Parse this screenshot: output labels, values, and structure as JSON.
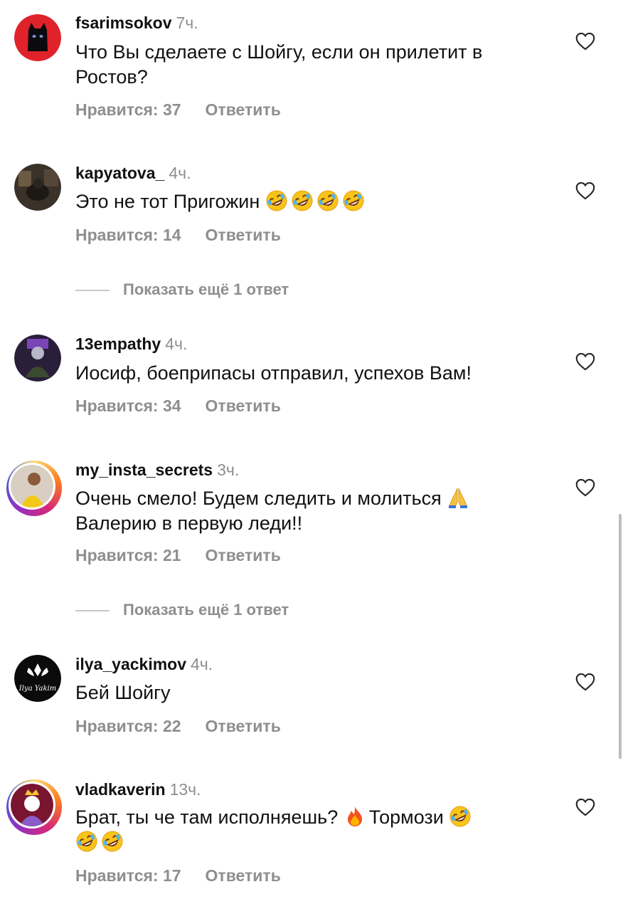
{
  "comments": [
    {
      "username": "fsarimsokov",
      "time": "7ч.",
      "text": "Что Вы сделаете с Шойгу, если он прилетит в Ростов?",
      "likes_label": "Нравится: 37",
      "reply_label": "Ответить",
      "avatar_icon": "black-cat-avatar",
      "avatar_color": "#e0222b"
    },
    {
      "username": "kapyatova_",
      "time": "4ч.",
      "text": "Это не тот Пригожин",
      "emoji": [
        "rofl-emoji",
        "rofl-emoji",
        "rofl-emoji",
        "rofl-emoji"
      ],
      "likes_label": "Нравится: 14",
      "reply_label": "Ответить",
      "avatar_icon": "dark-room-photo-avatar"
    },
    {
      "username": "13empathy",
      "time": "4ч.",
      "text": "Иосиф, боеприпасы отправил, успехов Вам!",
      "likes_label": "Нравится: 34",
      "reply_label": "Ответить",
      "avatar_icon": "purple-figure-avatar"
    },
    {
      "username": "my_insta_secrets",
      "time": "3ч.",
      "text": "Очень смело! Будем следить и молиться",
      "text2": "Валерию в первую леди!!",
      "emoji": [
        "pray-emoji"
      ],
      "likes_label": "Нравится: 21",
      "reply_label": "Ответить",
      "avatar_icon": "woman-yellow-avatar"
    },
    {
      "username": "ilya_yackimov",
      "time": "4ч.",
      "text": "Бей Шойгу",
      "likes_label": "Нравится: 22",
      "reply_label": "Ответить",
      "avatar_icon": "ilya-yakim-logo-avatar",
      "avatar_text": "Ilya Yakim"
    },
    {
      "username": "vladkaverin",
      "time": "13ч.",
      "text": "Брат, ты че там исполняешь?",
      "text_after": "Тормози",
      "emoji_mid": [
        "fire-emoji"
      ],
      "emoji_end": [
        "rofl-emoji"
      ],
      "emoji_line2": [
        "rofl-emoji",
        "rofl-emoji"
      ],
      "likes_label": "Нравится: 17",
      "reply_label": "Ответить",
      "avatar_icon": "king-cartoon-avatar"
    }
  ],
  "show_more": [
    {
      "label": "Показать ещё 1 ответ"
    },
    {
      "label": "Показать ещё 1 ответ"
    }
  ],
  "colors": {
    "secondary_text": "#8e8e8e",
    "primary_text": "#111111"
  }
}
